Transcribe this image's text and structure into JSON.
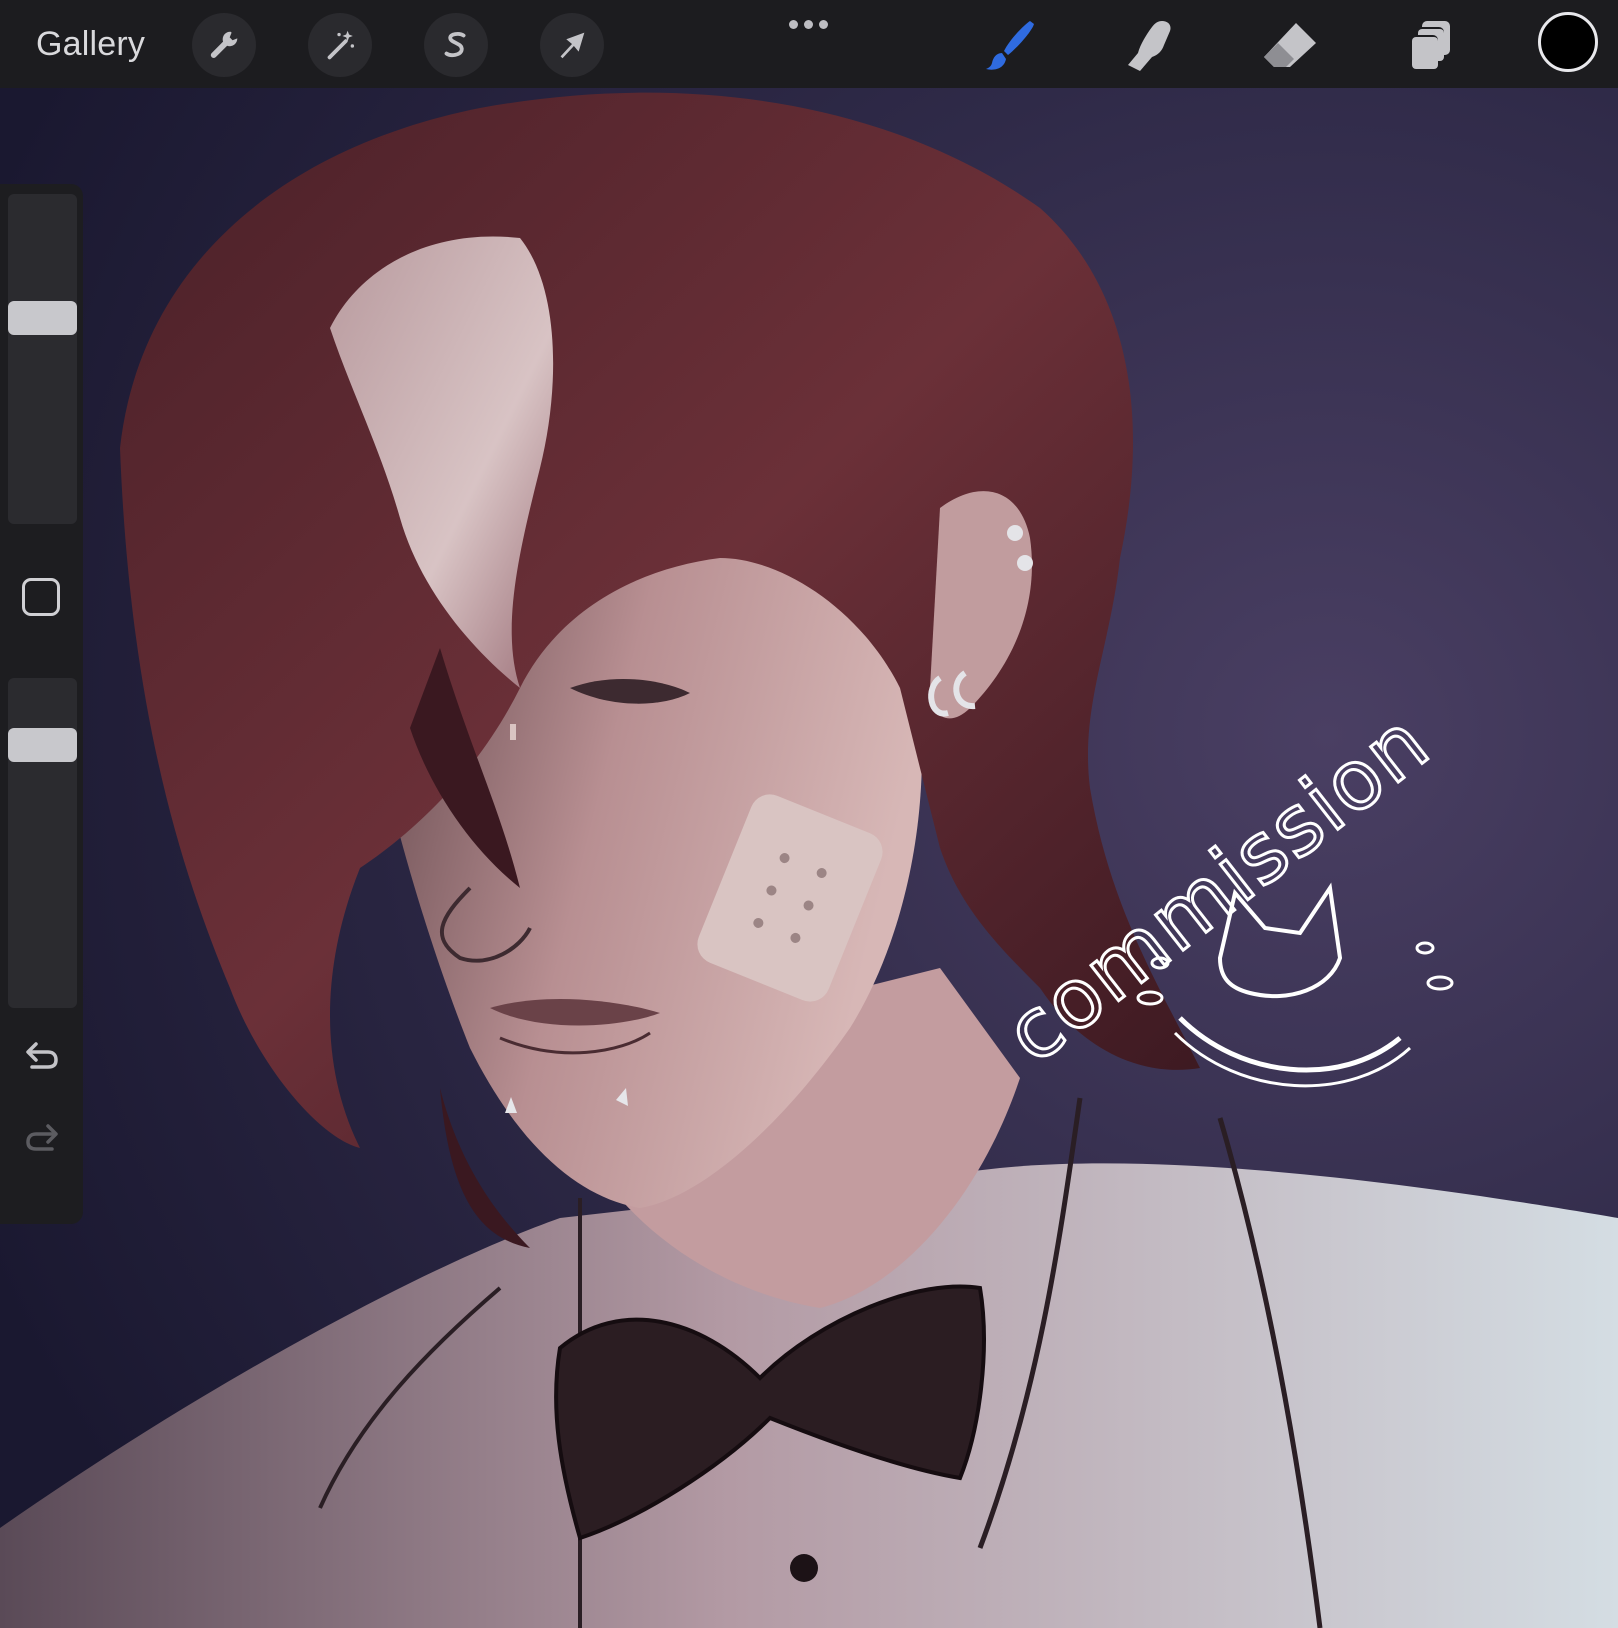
{
  "app": {
    "gallery_label": "Gallery"
  },
  "toolbar_left": [
    {
      "name": "actions",
      "icon": "wrench-icon"
    },
    {
      "name": "adjustments",
      "icon": "magic-wand-icon"
    },
    {
      "name": "selection",
      "icon": "selection-s-icon"
    },
    {
      "name": "transform",
      "icon": "arrow-cursor-icon"
    }
  ],
  "toolbar_right": [
    {
      "name": "brush",
      "icon": "brush-icon",
      "active": true
    },
    {
      "name": "smudge",
      "icon": "smudge-finger-icon",
      "active": false
    },
    {
      "name": "eraser",
      "icon": "eraser-icon",
      "active": false
    },
    {
      "name": "layers",
      "icon": "layers-icon",
      "active": false
    }
  ],
  "colors": {
    "toolbar_bg": "#1c1c1f",
    "active_tool": "#2f6be0",
    "icon_gray": "#c4c4c8",
    "current_color": "#000000",
    "canvas_bg_top": "#2f2a48",
    "canvas_bg_bottom": "#1a1830"
  },
  "sidebar": {
    "brush_size_level": 0.64,
    "brush_opacity_level": 0.83,
    "icons": [
      "square-modify-icon",
      "undo-icon",
      "redo-icon"
    ]
  },
  "canvas": {
    "watermark_text": "commission"
  }
}
